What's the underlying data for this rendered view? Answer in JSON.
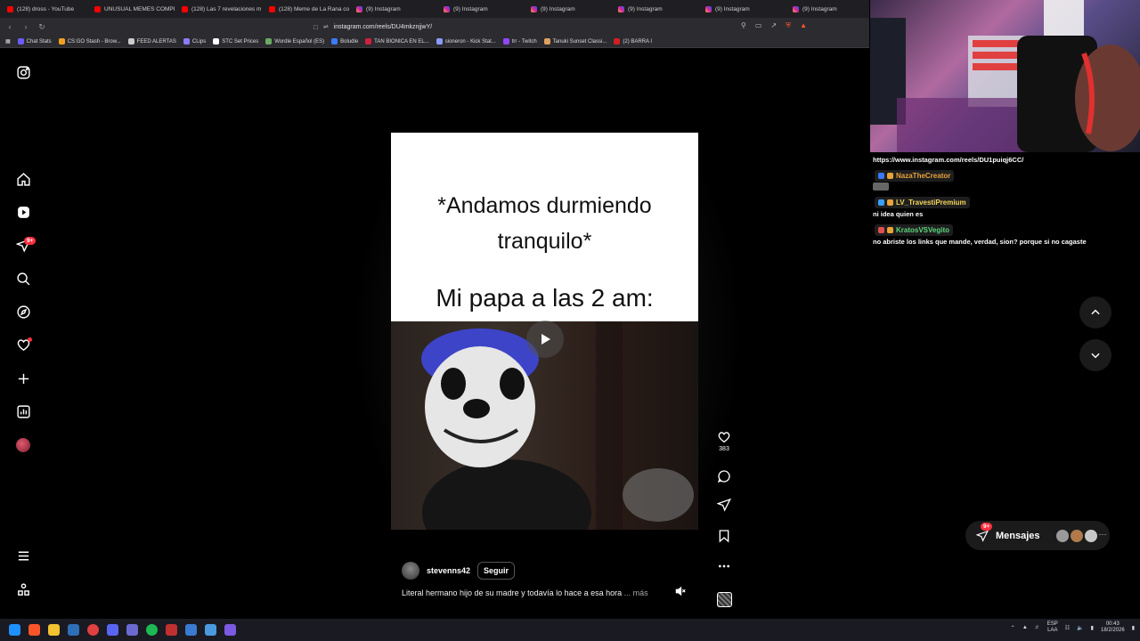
{
  "browser": {
    "tabs": [
      {
        "label": "(128) dross - YouTube",
        "favicon": "youtube-icon"
      },
      {
        "label": "UNUSUAL MEMES COMPI...",
        "favicon": "youtube-icon"
      },
      {
        "label": "(128) Las 7 revelaciones m...",
        "favicon": "youtube-icon"
      },
      {
        "label": "(128) Meme de La Rana co...",
        "favicon": "youtube-icon"
      },
      {
        "label": "(9) Instagram",
        "favicon": "instagram-icon"
      },
      {
        "label": "(9) Instagram",
        "favicon": "instagram-icon"
      },
      {
        "label": "(9) Instagram",
        "favicon": "instagram-icon"
      },
      {
        "label": "(9) Instagram",
        "favicon": "instagram-icon"
      },
      {
        "label": "(9) Instagram",
        "favicon": "instagram-icon"
      },
      {
        "label": "(9) Instagram",
        "favicon": "instagram-icon"
      }
    ],
    "url": "instagram.com/reels/DU4mkznjjwY/",
    "bookmarks": [
      {
        "label": "Chat Stats",
        "color": "#6a5cff"
      },
      {
        "label": "CS:GO Stash - Brow...",
        "color": "#f0a020"
      },
      {
        "label": "FEED ALERTAS",
        "color": "#cccccc"
      },
      {
        "label": "CLips",
        "color": "#8a7cff"
      },
      {
        "label": "STC Set Prices",
        "color": "#ffffff"
      },
      {
        "label": "Wordle Español (ES)",
        "color": "#6aaa64"
      },
      {
        "label": "Boludle",
        "color": "#3c7bff"
      },
      {
        "label": "TAN BIONICA EN EL...",
        "color": "#d02040"
      },
      {
        "label": "sioneron - Kick Stat...",
        "color": "#8a9cff"
      },
      {
        "label": "trr - Twitch",
        "color": "#9146ff"
      },
      {
        "label": "Tanuki Sunset Classi...",
        "color": "#e0a060"
      },
      {
        "label": "(2) BARRA I",
        "color": "#d02020"
      }
    ]
  },
  "instagram": {
    "notifications_badge": "9+",
    "reel": {
      "meme_line1": "*Andamos durmiendo tranquilo*",
      "meme_line2": "Mi papa a las 2 am:",
      "author": "stevenns42",
      "follow_label": "Seguir",
      "caption": "Literal hermano hijo de su madre y todavía lo hace a esa hora",
      "caption_more": "... más",
      "likes": "383"
    },
    "messages": {
      "label": "Mensajes",
      "badge": "9+"
    }
  },
  "stream": {
    "chat_url": "https://www.instagram.com/reels/DU1puiqj6CC/",
    "chat": [
      {
        "user": "NazaTheCreator",
        "user_color": "#e8a33a",
        "message": ""
      },
      {
        "user": "LV_TravestiPremium",
        "user_color": "#f4d45a",
        "message": "ni idea quien es"
      },
      {
        "user": "KratosVSVegito",
        "user_color": "#5ad67a",
        "message": "no abriste los links que mande, verdad, sion? porque si no cagaste"
      }
    ]
  },
  "taskbar": {
    "lang_top": "ESP",
    "lang_bottom": "LAA",
    "time": "00:43",
    "date": "18/2/2026"
  }
}
